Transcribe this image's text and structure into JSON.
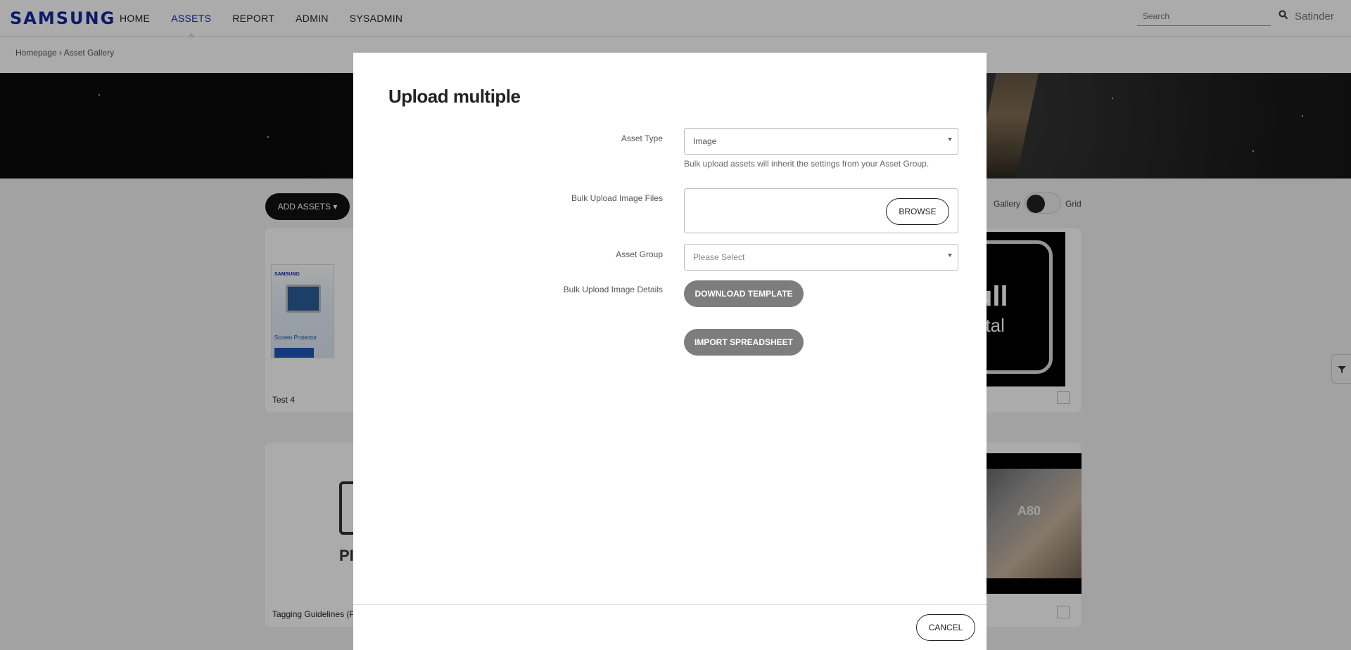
{
  "header": {
    "logo": "SAMSUNG",
    "nav": [
      "HOME",
      "ASSETS",
      "REPORT",
      "ADMIN",
      "SYSADMIN"
    ],
    "active_nav": "ASSETS",
    "search_placeholder": "Search",
    "user": "Satinder"
  },
  "breadcrumb": "Homepage › Asset Gallery",
  "background": {
    "add_assets": "ADD ASSETS ▾",
    "toggle_left": "Gallery",
    "toggle_right": "Grid",
    "cards": [
      {
        "title": "Test 4"
      },
      {
        "title": "Tagging Guidelines (P"
      }
    ],
    "doc_text": "PI",
    "thumb_text_1": "ull",
    "thumb_text_2": "etal",
    "thumb_text_3": "A80",
    "tablet_brand": "SAMSUNG",
    "tablet_caption": "Screen Protector"
  },
  "modal": {
    "title": "Upload multiple",
    "fields": {
      "asset_type_label": "Asset Type",
      "asset_type_value": "Image",
      "asset_type_hint": "Bulk upload assets will inherit the settings from your Asset Group.",
      "bulk_files_label": "Bulk Upload Image Files",
      "browse": "BROWSE",
      "asset_group_label": "Asset Group",
      "asset_group_placeholder": "Please Select",
      "details_label": "Bulk Upload Image Details",
      "download_template": "DOWNLOAD TEMPLATE",
      "import_spreadsheet": "IMPORT SPREADSHEET"
    },
    "cancel": "CANCEL"
  },
  "colors": {
    "brand": "#1428a0",
    "overlay": "rgba(0,0,0,0.33)",
    "gray_button": "#7d7d7d"
  }
}
